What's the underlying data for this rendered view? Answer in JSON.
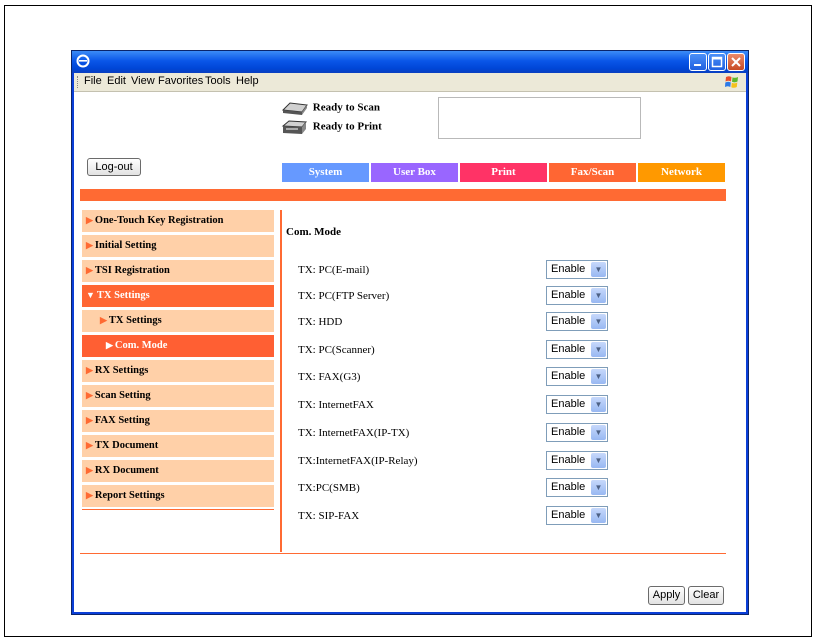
{
  "window": {
    "icon": "ie-icon"
  },
  "menu": [
    "File",
    "Edit",
    "View",
    "Favorites",
    "Tools",
    "Help"
  ],
  "status": {
    "scan": "Ready to Scan",
    "print": "Ready to Print"
  },
  "logout_label": "Log-out",
  "tabs": [
    {
      "label": "System",
      "color": "#6699ff"
    },
    {
      "label": "User Box",
      "color": "#9966ff"
    },
    {
      "label": "Print",
      "color": "#ff3366"
    },
    {
      "label": "Fax/Scan",
      "color": "#ff6633"
    },
    {
      "label": "Network",
      "color": "#ff9900"
    }
  ],
  "sidebar": [
    {
      "label": "One-Touch Key Registration",
      "level": 0,
      "active": false,
      "expanded": false
    },
    {
      "label": "Initial Setting",
      "level": 0,
      "active": false,
      "expanded": false
    },
    {
      "label": "TSI Registration",
      "level": 0,
      "active": false,
      "expanded": false
    },
    {
      "label": "TX Settings",
      "level": 0,
      "active": true,
      "expanded": true
    },
    {
      "label": "TX Settings",
      "level": 1,
      "active": false,
      "expanded": false
    },
    {
      "label": "Com. Mode",
      "level": 2,
      "active": true,
      "expanded": false
    },
    {
      "label": "RX Settings",
      "level": 0,
      "active": false,
      "expanded": false
    },
    {
      "label": "Scan Setting",
      "level": 0,
      "active": false,
      "expanded": false
    },
    {
      "label": "FAX Setting",
      "level": 0,
      "active": false,
      "expanded": false
    },
    {
      "label": "TX Document",
      "level": 0,
      "active": false,
      "expanded": false
    },
    {
      "label": "RX Document",
      "level": 0,
      "active": false,
      "expanded": false
    },
    {
      "label": "Report Settings",
      "level": 0,
      "active": false,
      "expanded": false
    }
  ],
  "main": {
    "title": "Com. Mode",
    "rows": [
      {
        "label": "TX: PC(E-mail)",
        "value": "Enable"
      },
      {
        "label": "TX: PC(FTP Server)",
        "value": "Enable"
      },
      {
        "label": "TX: HDD",
        "value": "Enable"
      },
      {
        "label": "TX: PC(Scanner)",
        "value": "Enable"
      },
      {
        "label": "TX: FAX(G3)",
        "value": "Enable"
      },
      {
        "label": "TX: InternetFAX",
        "value": "Enable"
      },
      {
        "label": "TX: InternetFAX(IP-TX)",
        "value": "Enable"
      },
      {
        "label": "TX:InternetFAX(IP-Relay)",
        "value": "Enable"
      },
      {
        "label": "TX:PC(SMB)",
        "value": "Enable"
      },
      {
        "label": "TX: SIP-FAX",
        "value": "Enable"
      }
    ]
  },
  "buttons": {
    "apply": "Apply",
    "clear": "Clear"
  }
}
